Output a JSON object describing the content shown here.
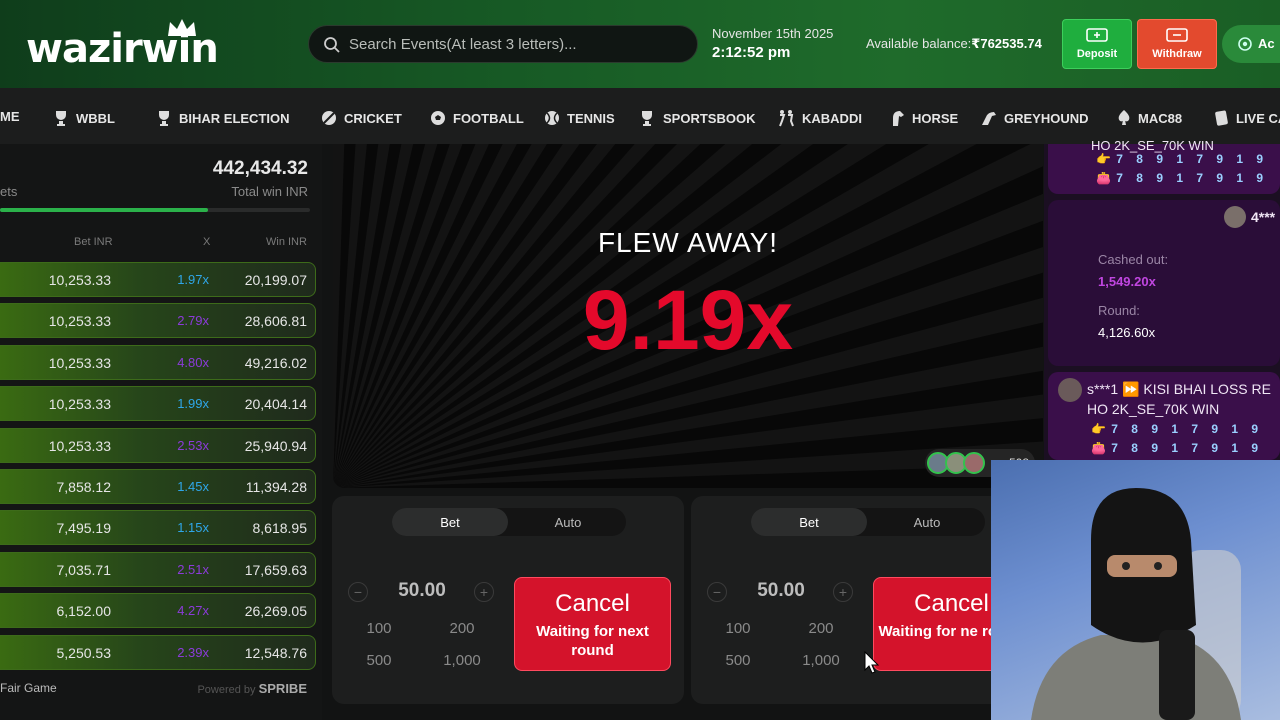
{
  "header": {
    "logo_text": "wazirwin",
    "search_placeholder": "Search Events(At least 3 letters)...",
    "date": "November 15th 2025",
    "time": "2:12:52 pm",
    "balance_label": "Available balance:",
    "balance_value": "₹762535.74",
    "deposit_label": "Deposit",
    "withdraw_label": "Withdraw",
    "account_label": "Ac"
  },
  "nav": {
    "items": [
      "ME",
      "WBBL",
      "BIHAR ELECTION",
      "CRICKET",
      "FOOTBALL",
      "TENNIS",
      "SPORTSBOOK",
      "KABADDI",
      "HORSE",
      "GREYHOUND",
      "MAC88",
      "LIVE CA"
    ]
  },
  "bets_panel": {
    "total_win_value": "442,434.32",
    "total_win_label": "Total win INR",
    "bets_label": "ets",
    "progress": 0.67,
    "col_bet": "Bet INR",
    "col_x": "X",
    "col_win": "Win INR",
    "rows": [
      {
        "bet": "10,253.33",
        "mult": "1.97x",
        "win": "20,199.07",
        "color": "#2fa6e8"
      },
      {
        "bet": "10,253.33",
        "mult": "2.79x",
        "win": "28,606.81",
        "color": "#8b3bd9"
      },
      {
        "bet": "10,253.33",
        "mult": "4.80x",
        "win": "49,216.02",
        "color": "#8b3bd9"
      },
      {
        "bet": "10,253.33",
        "mult": "1.99x",
        "win": "20,404.14",
        "color": "#2fa6e8"
      },
      {
        "bet": "10,253.33",
        "mult": "2.53x",
        "win": "25,940.94",
        "color": "#8b3bd9"
      },
      {
        "bet": "7,858.12",
        "mult": "1.45x",
        "win": "11,394.28",
        "color": "#2fa6e8"
      },
      {
        "bet": "7,495.19",
        "mult": "1.15x",
        "win": "8,618.95",
        "color": "#2fa6e8"
      },
      {
        "bet": "7,035.71",
        "mult": "2.51x",
        "win": "17,659.63",
        "color": "#8b3bd9"
      },
      {
        "bet": "6,152.00",
        "mult": "4.27x",
        "win": "26,269.05",
        "color": "#8b3bd9"
      },
      {
        "bet": "5,250.53",
        "mult": "2.39x",
        "win": "12,548.76",
        "color": "#8b3bd9"
      }
    ],
    "fair_label": "Fair Game",
    "powered_label": "Powered by",
    "powered_brand": "SPRIBE"
  },
  "game": {
    "status": "FLEW AWAY!",
    "multiplier": "9.19x",
    "player_count": "508"
  },
  "bet_controls": [
    {
      "tab_bet": "Bet",
      "tab_auto": "Auto",
      "amount": "50.00",
      "minus": "−",
      "plus": "+",
      "q1": "100",
      "q2": "200",
      "q3": "500",
      "q4": "1,000",
      "cancel": "Cancel",
      "waiting": "Waiting for next round"
    },
    {
      "tab_bet": "Bet",
      "tab_auto": "Auto",
      "amount": "50.00",
      "minus": "−",
      "plus": "+",
      "q1": "100",
      "q2": "200",
      "q3": "500",
      "q4": "1,000",
      "cancel": "Cancel",
      "waiting": "Waiting for ne round"
    }
  ],
  "chat": {
    "msg1_top": "HO 2K_SE_70K WIN",
    "user2": "4***",
    "cashed_label": "Cashed out:",
    "cashed_value": "1,549.20x",
    "round_label": "Round:",
    "round_value": "4,126.60x",
    "user3": "s***1",
    "msg3_line1": "KISI BHAI LOSS RE",
    "msg3_line2": "HO 2K_SE_70K WIN",
    "digits": "7 8 9 1 7 9 1 9"
  },
  "colors": {
    "accent_green": "#1fae3e",
    "withdraw_red": "#e34a2e",
    "multiplier_red": "#e4092b",
    "cancel_red": "#d4132b"
  }
}
